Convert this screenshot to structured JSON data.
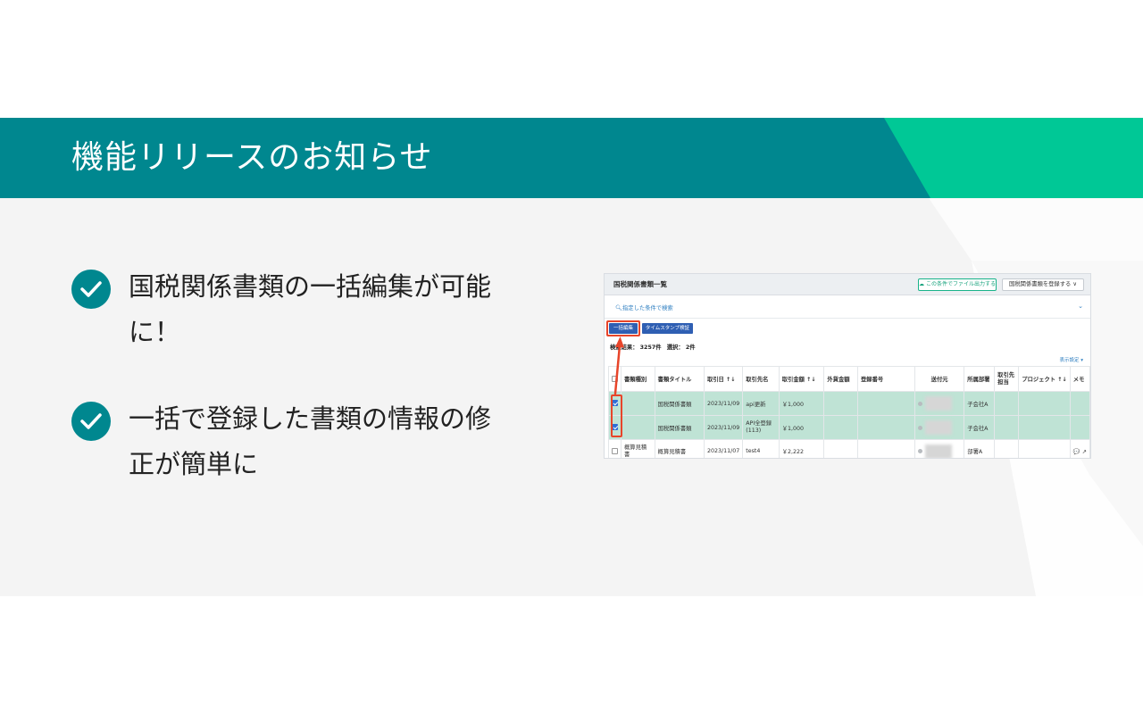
{
  "banner": {
    "title": "機能リリースのお知らせ"
  },
  "bullets": [
    {
      "text": "国税関係書類の一括編集が可能に！"
    },
    {
      "text": "一括で登録した書類の情報の修正が簡単に"
    }
  ],
  "screenshot": {
    "title": "国税関係書類一覧",
    "export_button": "この条件でファイル出力する",
    "register_button": "国税関係書類を登録する ∨",
    "search_link": "指定した条件で検索",
    "bulk_edit_button": "一括編集",
    "timestamp_button": "タイムスタンプ検証",
    "count_text": "検索結果： 3257件　選択： 2件",
    "display_setting": "表示設定 ▾",
    "columns": [
      "書類種別",
      "書類タイトル",
      "取引日 ↑↓",
      "取引先名",
      "取引金額 ↑↓",
      "外貨金額",
      "登録番号",
      "送付元",
      "所属部署",
      "取引先担当",
      "プロジェクト ↑↓",
      "メモ"
    ],
    "rows": [
      {
        "selected": true,
        "doc_type": "",
        "doc_title": "国税関係書類",
        "date": "2023/11/09",
        "partner": "api更新",
        "amount": "￥1,000",
        "fx": "",
        "reg_no": "",
        "dept": "子会社A",
        "contact": "",
        "project": "",
        "memo": ""
      },
      {
        "selected": true,
        "doc_type": "",
        "doc_title": "国税関係書類",
        "date": "2023/11/09",
        "partner": "API全登録 (113)",
        "amount": "￥1,000",
        "fx": "",
        "reg_no": "",
        "dept": "子会社A",
        "contact": "",
        "project": "",
        "memo": ""
      },
      {
        "selected": false,
        "doc_type": "概算見積書",
        "doc_title": "概算見積書",
        "date": "2023/11/07",
        "partner": "test4",
        "amount": "￥2,222",
        "fx": "",
        "reg_no": "",
        "dept": "部署A",
        "contact": "",
        "project": "",
        "memo": "💬 ↗"
      }
    ]
  },
  "colors": {
    "banner_teal": "#00878f",
    "banner_accent": "#00c896",
    "check_teal": "#00878f",
    "highlight_red": "#e8452a",
    "button_blue": "#2f5fb3",
    "selected_row": "#bfe3d5"
  },
  "icons": {
    "check": "check-icon",
    "search": "search-icon",
    "cloud_download": "cloud-download-icon",
    "arrow": "arrow-up-icon"
  }
}
